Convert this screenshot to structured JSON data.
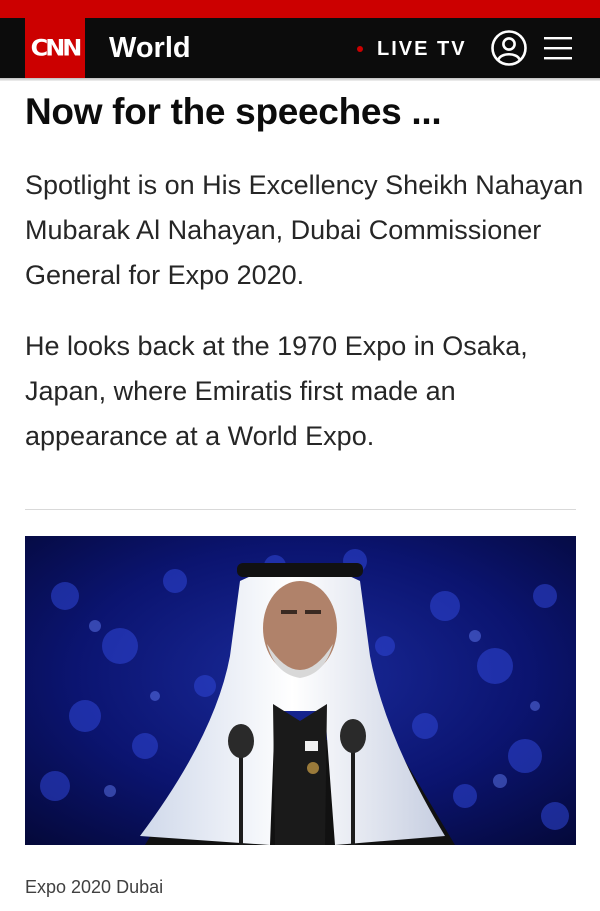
{
  "header": {
    "logo_text": "CNN",
    "section": "World",
    "live_label": "LIVE TV",
    "icons": [
      "account-icon",
      "menu-icon"
    ],
    "brand_color": "#cc0000"
  },
  "article": {
    "headline": "Now for the speeches ...",
    "paragraphs": [
      "Spotlight is on His Excellency Sheikh Nahayan Mubarak Al Nahayan, Dubai Commissioner General for Expo 2020.",
      "He looks back at the 1970 Expo in Osaka, Japan, where Emiratis first made an appearance at a World Expo."
    ],
    "image_caption": "Expo 2020 Dubai"
  }
}
